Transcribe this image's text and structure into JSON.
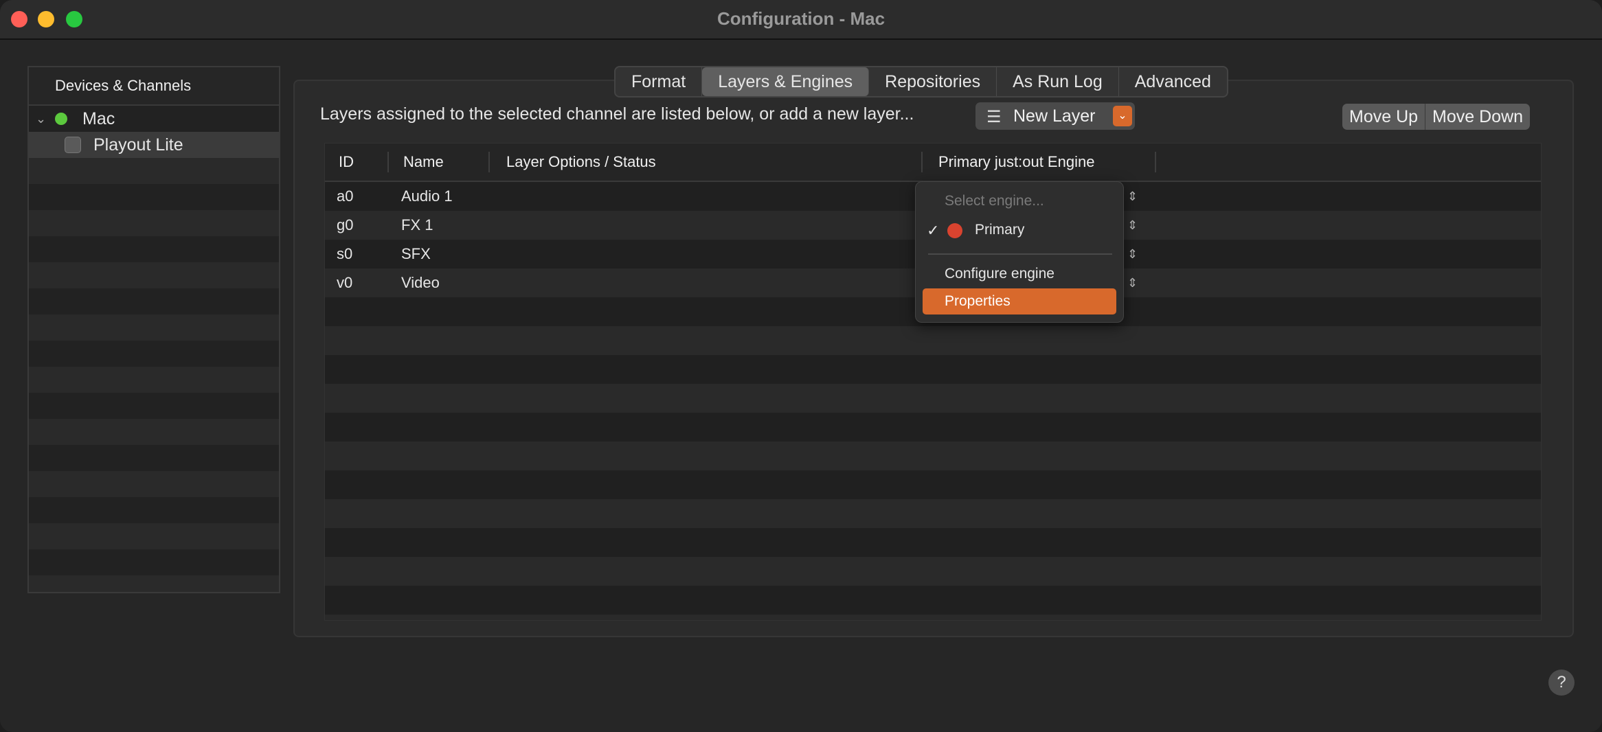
{
  "window": {
    "title": "Configuration - Mac"
  },
  "sidebar": {
    "header": "Devices & Channels",
    "device": {
      "name": "Mac",
      "status_color": "#5cc93e"
    },
    "channel": {
      "name": "Playout Lite"
    }
  },
  "tabs": [
    {
      "label": "Format"
    },
    {
      "label": "Layers & Engines",
      "active": true
    },
    {
      "label": "Repositories"
    },
    {
      "label": "As Run Log"
    },
    {
      "label": "Advanced"
    }
  ],
  "toolbar": {
    "description": "Layers assigned to the selected channel are listed below, or add a new layer...",
    "new_layer_label": "New Layer",
    "move_up_label": "Move Up",
    "move_down_label": "Move Down"
  },
  "table": {
    "columns": [
      "ID",
      "Name",
      "Layer Options / Status",
      "Primary just:out Engine"
    ],
    "rows": [
      {
        "id": "a0",
        "name": "Audio 1"
      },
      {
        "id": "g0",
        "name": "FX 1"
      },
      {
        "id": "s0",
        "name": "SFX"
      },
      {
        "id": "v0",
        "name": "Video"
      }
    ]
  },
  "engine_menu": {
    "placeholder": "Select engine...",
    "checked_item": "Primary",
    "checked_color": "#d9432f",
    "configure_label": "Configure engine",
    "highlighted_item": "Properties"
  },
  "help": {
    "label": "?"
  },
  "colors": {
    "accent": "#d8692c"
  }
}
